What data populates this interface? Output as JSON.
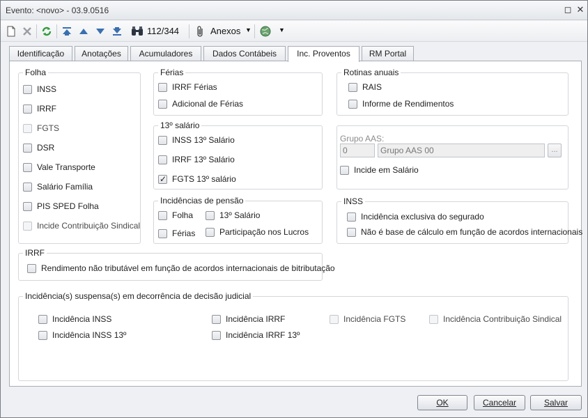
{
  "window": {
    "title": "Evento: <novo> - 03.9.0516",
    "restore_glyph": "◻",
    "close_glyph": "✕"
  },
  "toolbar": {
    "icons": [
      "new-icon",
      "delete-icon",
      "refresh-icon",
      "first-record-icon",
      "previous-record-icon",
      "next-record-icon",
      "last-record-icon",
      "binoculars-icon"
    ],
    "record_counter": "112/344",
    "attachments_label": "Anexos",
    "dropdown_glyph": "▼"
  },
  "tabs": [
    "Identificação",
    "Anotações",
    "Acumuladores",
    "Dados Contábeis",
    "Inc. Proventos",
    "RM Portal"
  ],
  "active_tab": "Inc. Proventos",
  "folha": {
    "title": "Folha",
    "items": [
      {
        "label": "INSS",
        "checked": false,
        "enabled": true
      },
      {
        "label": "IRRF",
        "checked": false,
        "enabled": true
      },
      {
        "label": "FGTS",
        "checked": false,
        "enabled": false
      },
      {
        "label": "DSR",
        "checked": false,
        "enabled": true
      },
      {
        "label": "Vale Transporte",
        "checked": false,
        "enabled": true
      },
      {
        "label": "Salário Família",
        "checked": false,
        "enabled": true
      },
      {
        "label": "PIS SPED Folha",
        "checked": false,
        "enabled": true
      },
      {
        "label": "Incide Contribuição Sindical",
        "checked": false,
        "enabled": false
      }
    ]
  },
  "ferias": {
    "title": "Férias",
    "items": [
      {
        "label": "IRRF Férias",
        "checked": false
      },
      {
        "label": "Adicional de Férias",
        "checked": false
      }
    ]
  },
  "decimo_terceiro": {
    "title": "13º salário",
    "items": [
      {
        "label": "INSS 13º Salário",
        "checked": false
      },
      {
        "label": "IRRF 13º Salário",
        "checked": false
      },
      {
        "label": "FGTS 13º salário",
        "checked": true
      }
    ]
  },
  "pensao": {
    "title": "Incidências de pensão",
    "items": [
      {
        "label": "Folha",
        "checked": false
      },
      {
        "label": "13º Salário",
        "checked": false
      },
      {
        "label": "Férias",
        "checked": false
      },
      {
        "label": "Participação nos Lucros",
        "checked": false
      }
    ]
  },
  "rotinas_anuais": {
    "title": "Rotinas anuais",
    "items": [
      {
        "label": "RAIS",
        "checked": false
      },
      {
        "label": "Informe de Rendimentos",
        "checked": false
      }
    ]
  },
  "grupo_aas": {
    "label": "Grupo AAS:",
    "code_value": "0",
    "name_value": "Grupo AAS 00",
    "lookup_glyph": "...",
    "incide_salario_label": "Incide em Salário",
    "incide_salario_checked": false
  },
  "inss": {
    "title": "INSS",
    "items": [
      {
        "label": "Incidência exclusiva do segurado",
        "checked": false
      },
      {
        "label": "Não é base de cálculo em função de acordos internacionais",
        "checked": false
      }
    ]
  },
  "irrf": {
    "title": "IRRF",
    "items": [
      {
        "label": "Rendimento não tributável em função de acordos internacionais de bitributação",
        "checked": false
      }
    ]
  },
  "suspensas": {
    "title": "Incidência(s) suspensa(s) em decorrência de decisão judicial",
    "items": [
      {
        "label": "Incidência INSS",
        "checked": false,
        "enabled": true
      },
      {
        "label": "Incidência IRRF",
        "checked": false,
        "enabled": true
      },
      {
        "label": "Incidência FGTS",
        "checked": false,
        "enabled": false
      },
      {
        "label": "Incidência Contribuição Sindical",
        "checked": false,
        "enabled": false
      },
      {
        "label": "Incidência INSS 13º",
        "checked": false,
        "enabled": true
      },
      {
        "label": "Incidência IRRF 13º",
        "checked": false,
        "enabled": true
      }
    ]
  },
  "footer": {
    "ok_label": "OK",
    "cancel_label": "Cancelar",
    "save_label": "Salvar"
  },
  "colors": {
    "accent": "#3a6fb0",
    "border": "#a9adb4",
    "refresh_green": "#2e9b3a"
  }
}
